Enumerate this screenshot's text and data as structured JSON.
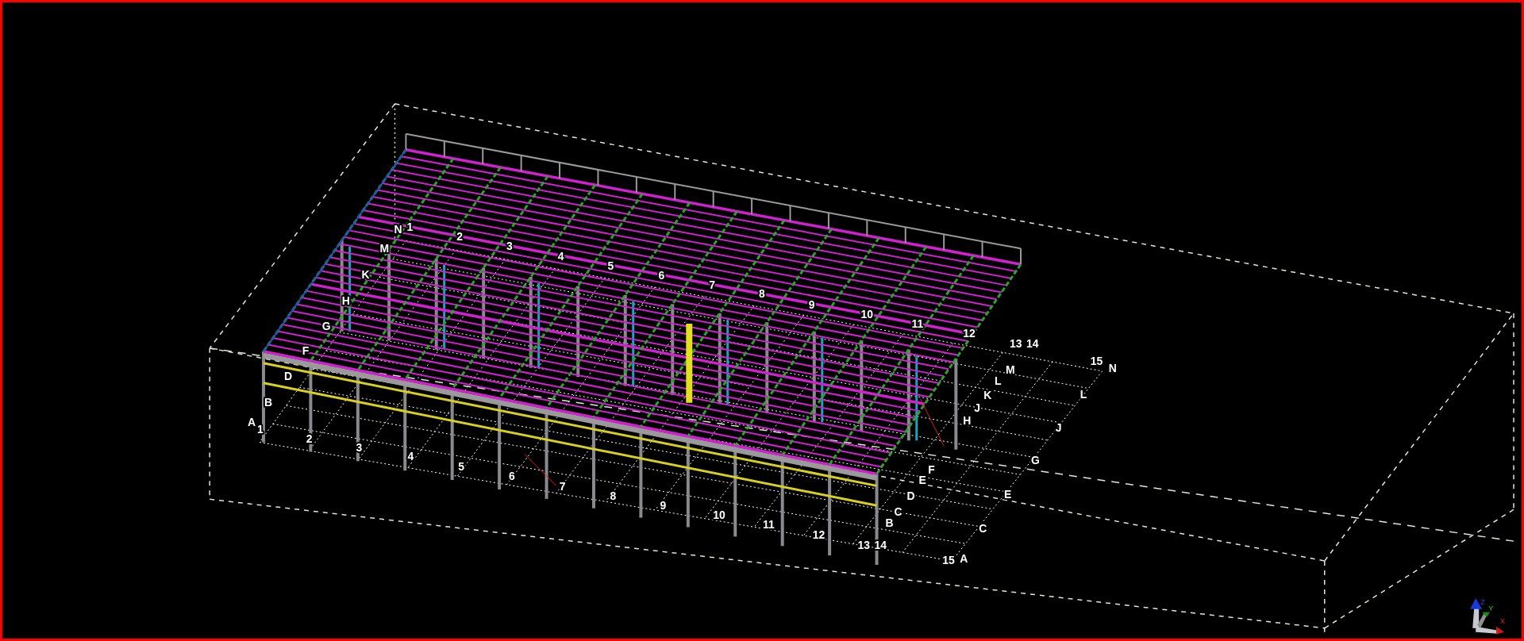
{
  "viewport": {
    "grid_labels": [
      {
        "text": "N"
      },
      {
        "text": "1"
      },
      {
        "text": "2"
      },
      {
        "text": "3"
      },
      {
        "text": "4"
      },
      {
        "text": "5"
      },
      {
        "text": "6"
      },
      {
        "text": "7"
      },
      {
        "text": "8"
      },
      {
        "text": "9"
      },
      {
        "text": "10"
      },
      {
        "text": "11"
      },
      {
        "text": "12"
      },
      {
        "text": "13"
      },
      {
        "text": "14"
      },
      {
        "text": "M"
      },
      {
        "text": "K"
      },
      {
        "text": "H"
      },
      {
        "text": "G"
      },
      {
        "text": "F"
      },
      {
        "text": "D"
      },
      {
        "text": "B"
      },
      {
        "text": "A"
      },
      {
        "text": "1"
      },
      {
        "text": "15"
      },
      {
        "text": "N"
      },
      {
        "text": "M"
      },
      {
        "text": "L"
      },
      {
        "text": "L"
      },
      {
        "text": "K"
      },
      {
        "text": "J"
      },
      {
        "text": "H"
      },
      {
        "text": "J"
      },
      {
        "text": "G"
      },
      {
        "text": "F"
      },
      {
        "text": "E"
      },
      {
        "text": "D"
      },
      {
        "text": "E"
      },
      {
        "text": "C"
      },
      {
        "text": "B"
      },
      {
        "text": "C"
      },
      {
        "text": "2"
      },
      {
        "text": "3"
      },
      {
        "text": "4"
      },
      {
        "text": "5"
      },
      {
        "text": "6"
      },
      {
        "text": "7"
      },
      {
        "text": "8"
      },
      {
        "text": "9"
      },
      {
        "text": "10"
      },
      {
        "text": "11"
      },
      {
        "text": "12"
      },
      {
        "text": "13"
      },
      {
        "text": "14"
      },
      {
        "text": "15"
      },
      {
        "text": "A"
      }
    ],
    "axis_labels": [
      {
        "text": "Z"
      },
      {
        "text": "Y"
      },
      {
        "text": "X"
      }
    ]
  }
}
